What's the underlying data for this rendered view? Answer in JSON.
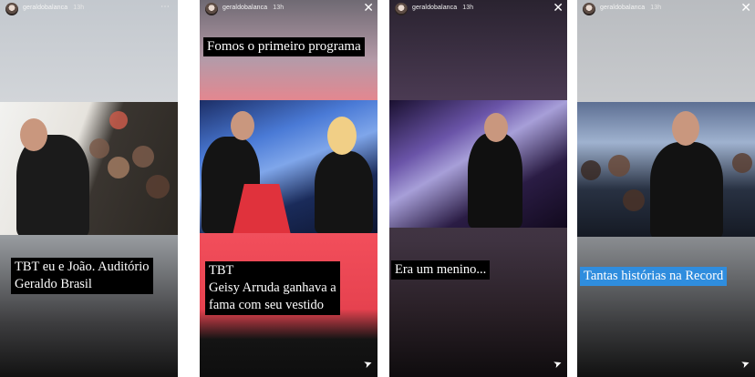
{
  "stories": [
    {
      "username": "geraldobalanca",
      "time": "13h",
      "caption": "TBT eu e João. Auditório\nGeraldo Brasil",
      "top_caption": ""
    },
    {
      "username": "geraldobalanca",
      "time": "13h",
      "caption": "TBT\nGeisy Arruda ganhava a\nfama com seu vestido",
      "top_caption": "Fomos o primeiro programa"
    },
    {
      "username": "geraldobalanca",
      "time": "13h",
      "caption": "Era um menino...",
      "top_caption": ""
    },
    {
      "username": "geraldobalanca",
      "time": "13h",
      "caption": "Tantas histórias na Record",
      "top_caption": ""
    }
  ],
  "icons": {
    "more": "ellipsis-icon",
    "close": "close-icon",
    "send": "send-icon"
  },
  "colors": {
    "caption_bg": "#000000",
    "caption_text": "#ffffff",
    "highlight_caption_bg": "#2f8dde"
  }
}
